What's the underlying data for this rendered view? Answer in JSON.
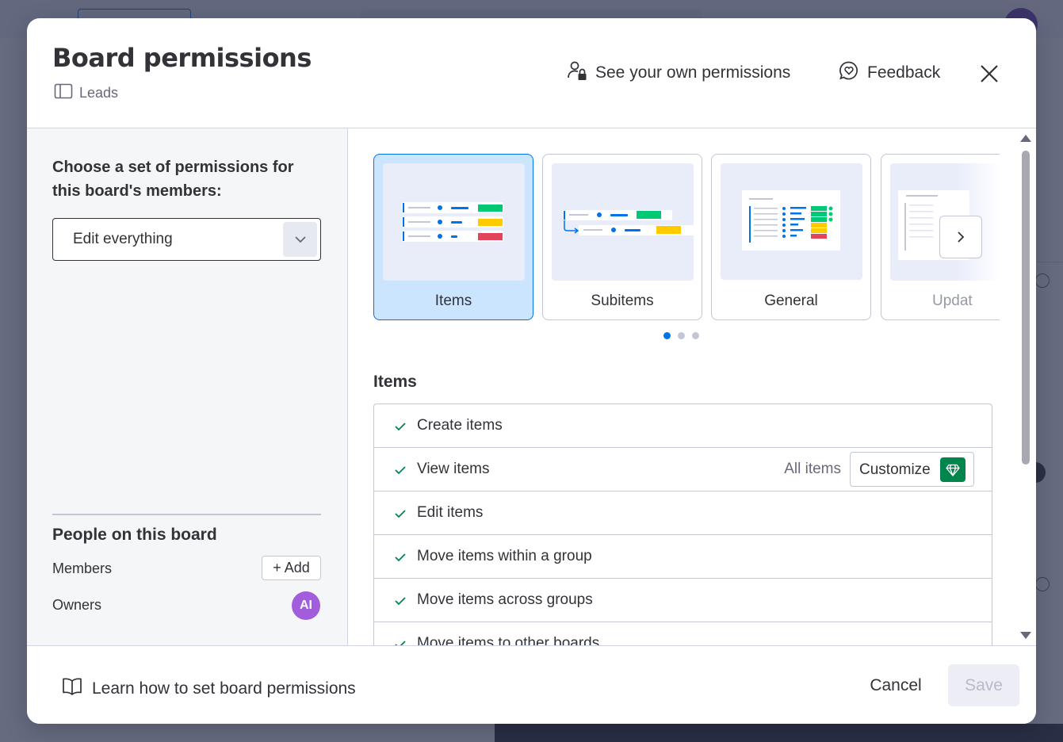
{
  "header": {
    "title": "Board permissions",
    "board_name": "Leads",
    "see_permissions_label": "See your own permissions",
    "feedback_label": "Feedback"
  },
  "left_panel": {
    "choose_label": "Choose a set of permissions for this board's members:",
    "selected_permission_set": "Edit everything",
    "people_title": "People on this board",
    "members_label": "Members",
    "add_label": "+ Add",
    "owners_label": "Owners",
    "owner_initials": "AI"
  },
  "categories": [
    {
      "label": "Items",
      "selected": true
    },
    {
      "label": "Subitems",
      "selected": false
    },
    {
      "label": "General",
      "selected": false
    },
    {
      "label": "Updat",
      "selected": false
    }
  ],
  "carousel": {
    "pages": 3,
    "active_page": 1
  },
  "items_section": {
    "title": "Items",
    "permissions": [
      {
        "label": "Create items",
        "checked": true
      },
      {
        "label": "View items",
        "checked": true,
        "scope": "All items",
        "action": "Customize"
      },
      {
        "label": "Edit items",
        "checked": true
      },
      {
        "label": "Move items within a group",
        "checked": true
      },
      {
        "label": "Move items across groups",
        "checked": true
      },
      {
        "label": "Move items to other boards",
        "checked": true
      }
    ]
  },
  "footer": {
    "learn_label": "Learn how to set board permissions",
    "cancel_label": "Cancel",
    "save_label": "Save"
  },
  "colors": {
    "accent": "#0073ea",
    "selected_card_bg": "#cce5ff",
    "check": "#00854d",
    "owner_avatar": "#a25ddc",
    "green": "#00c875",
    "yellow": "#ffcb00",
    "red": "#e2445c"
  }
}
